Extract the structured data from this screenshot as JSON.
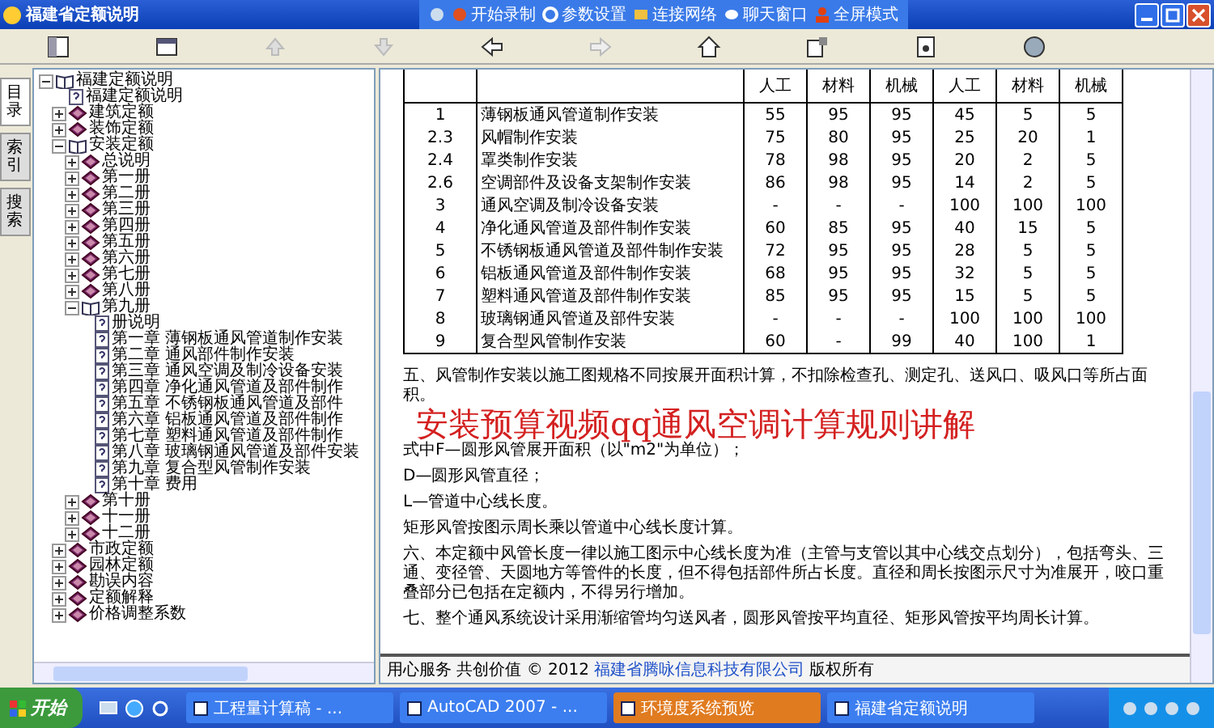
{
  "window": {
    "title": "福建省定额说明"
  },
  "recorder_bar": [
    {
      "label": "开始录制"
    },
    {
      "label": "参数设置"
    },
    {
      "label": "连接网络"
    },
    {
      "label": "聊天窗口"
    },
    {
      "label": "全屏模式"
    }
  ],
  "side_tabs": [
    {
      "label": "目录",
      "selected": true
    },
    {
      "label": "索引",
      "selected": false
    },
    {
      "label": "搜索",
      "selected": false
    }
  ],
  "tree": [
    {
      "label": "福建定额说明",
      "kind": "book",
      "expanded": true,
      "children": [
        {
          "label": "福建定额说明",
          "kind": "page"
        },
        {
          "label": "建筑定额",
          "kind": "book",
          "expanded": false
        },
        {
          "label": "装饰定额",
          "kind": "book",
          "expanded": false
        },
        {
          "label": "安装定额",
          "kind": "book",
          "expanded": true,
          "children": [
            {
              "label": "总说明",
              "kind": "book",
              "expanded": false
            },
            {
              "label": "第一册",
              "kind": "book",
              "expanded": false
            },
            {
              "label": "第二册",
              "kind": "book",
              "expanded": false
            },
            {
              "label": "第三册",
              "kind": "book",
              "expanded": false
            },
            {
              "label": "第四册",
              "kind": "book",
              "expanded": false
            },
            {
              "label": "第五册",
              "kind": "book",
              "expanded": false
            },
            {
              "label": "第六册",
              "kind": "book",
              "expanded": false
            },
            {
              "label": "第七册",
              "kind": "book",
              "expanded": false
            },
            {
              "label": "第八册",
              "kind": "book",
              "expanded": false
            },
            {
              "label": "第九册",
              "kind": "book",
              "expanded": true,
              "children": [
                {
                  "label": "册说明",
                  "kind": "page"
                },
                {
                  "label": "第一章 薄钢板通风管道制作安装",
                  "kind": "page"
                },
                {
                  "label": "第二章 通风部件制作安装",
                  "kind": "page"
                },
                {
                  "label": "第三章 通风空调及制冷设备安装",
                  "kind": "page"
                },
                {
                  "label": "第四章 净化通风管道及部件制作",
                  "kind": "page"
                },
                {
                  "label": "第五章 不锈钢板通风管道及部件",
                  "kind": "page"
                },
                {
                  "label": "第六章 铝板通风管道及部件制作",
                  "kind": "page"
                },
                {
                  "label": "第七章 塑料通风管道及部件制作",
                  "kind": "page"
                },
                {
                  "label": "第八章 玻璃钢通风管道及部件安装",
                  "kind": "page"
                },
                {
                  "label": "第九章 复合型风管制作安装",
                  "kind": "page"
                },
                {
                  "label": "第十章 费用",
                  "kind": "page"
                }
              ]
            },
            {
              "label": "第十册",
              "kind": "book",
              "expanded": false
            },
            {
              "label": "十一册",
              "kind": "book",
              "expanded": false
            },
            {
              "label": "十二册",
              "kind": "book",
              "expanded": false
            }
          ]
        },
        {
          "label": "市政定额",
          "kind": "book",
          "expanded": false
        },
        {
          "label": "园林定额",
          "kind": "book",
          "expanded": false
        },
        {
          "label": "勘误内容",
          "kind": "book",
          "expanded": false
        },
        {
          "label": "定额解释",
          "kind": "book",
          "expanded": false
        },
        {
          "label": "价格调整系数",
          "kind": "book",
          "expanded": false
        }
      ]
    }
  ],
  "table": {
    "columns": [
      "人工",
      "材料",
      "机械",
      "人工",
      "材料",
      "机械"
    ],
    "rows": [
      {
        "no": "1",
        "name": "薄钢板通风管道制作安装",
        "values": [
          "55",
          "95",
          "95",
          "45",
          "5",
          "5"
        ]
      },
      {
        "no": "2.3",
        "name": "风帽制作安装",
        "values": [
          "75",
          "80",
          "95",
          "25",
          "20",
          "1"
        ]
      },
      {
        "no": "2.4",
        "name": "罩类制作安装",
        "values": [
          "78",
          "98",
          "95",
          "20",
          "2",
          "5"
        ]
      },
      {
        "no": "2.6",
        "name": "空调部件及设备支架制作安装",
        "values": [
          "86",
          "98",
          "95",
          "14",
          "2",
          "5"
        ]
      },
      {
        "no": "3",
        "name": "通风空调及制冷设备安装",
        "values": [
          "-",
          "-",
          "-",
          "100",
          "100",
          "100"
        ]
      },
      {
        "no": "4",
        "name": "净化通风管道及部件制作安装",
        "values": [
          "60",
          "85",
          "95",
          "40",
          "15",
          "5"
        ]
      },
      {
        "no": "5",
        "name": "不锈钢板通风管道及部件制作安装",
        "values": [
          "72",
          "95",
          "95",
          "28",
          "5",
          "5"
        ]
      },
      {
        "no": "6",
        "name": "铝板通风管道及部件制作安装",
        "values": [
          "68",
          "95",
          "95",
          "32",
          "5",
          "5"
        ]
      },
      {
        "no": "7",
        "name": "塑料通风管道及部件制作安装",
        "values": [
          "85",
          "95",
          "95",
          "15",
          "5",
          "5"
        ]
      },
      {
        "no": "8",
        "name": "玻璃钢通风管道及部件安装",
        "values": [
          "-",
          "-",
          "-",
          "100",
          "100",
          "100"
        ]
      },
      {
        "no": "9",
        "name": "复合型风管制作安装",
        "values": [
          "60",
          "-",
          "99",
          "40",
          "100",
          "1"
        ]
      }
    ]
  },
  "paragraphs": [
    {
      "kind": "text",
      "text": "五、风管制作安装以施工图规格不同按展开面积计算，不扣除检查孔、测定孔、送风口、吸风口等所占面积。"
    },
    {
      "kind": "caption",
      "text": "安装预算视频qq通风空调计算规则讲解"
    },
    {
      "kind": "text",
      "text": "式中F—圆形风管展开面积（以\"m2\"为单位）；"
    },
    {
      "kind": "text",
      "text": "D—圆形风管直径；"
    },
    {
      "kind": "text",
      "text": "L—管道中心线长度。"
    },
    {
      "kind": "text",
      "text": "矩形风管按图示周长乘以管道中心线长度计算。"
    },
    {
      "kind": "text",
      "text": "六、本定额中风管长度一律以施工图示中心线长度为准（主管与支管以其中心线交点划分），包括弯头、三通、变径管、天圆地方等管件的长度，但不得包括部件所占长度。直径和周长按图示尺寸为准展开，咬口重叠部分已包括在定额内，不得另行增加。"
    },
    {
      "kind": "text",
      "text": "七、整个通风系统设计采用渐缩管均匀送风者，圆形风管按平均直径、矩形风管按平均周长计算。"
    }
  ],
  "footer": {
    "text": "用心服务 共创价值 © 2012",
    "link": "福建省腾咏信息科技有限公司",
    "suffix": "版权所有"
  },
  "taskbar": {
    "start": "开始",
    "tasks": [
      {
        "label": "工程量计算稿 - ...",
        "selected": false
      },
      {
        "label": "AutoCAD 2007 - ...",
        "selected": false
      },
      {
        "label": "环境度系统预览",
        "selected": true
      },
      {
        "label": "福建省定额说明",
        "selected": false
      }
    ]
  }
}
